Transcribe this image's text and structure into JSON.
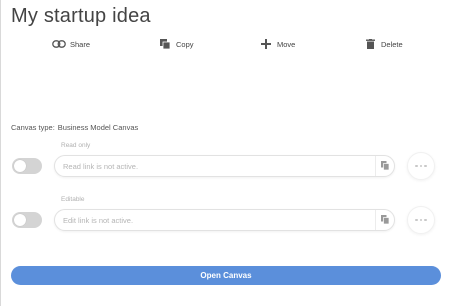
{
  "title": "My startup idea",
  "actions": {
    "share": {
      "label": "Share",
      "icon": "link-icon"
    },
    "copy": {
      "label": "Copy",
      "icon": "copy-icon"
    },
    "move": {
      "label": "Move",
      "icon": "move-icon"
    },
    "delete": {
      "label": "Delete",
      "icon": "trash-icon"
    }
  },
  "canvas_type": {
    "label": "Canvas type:",
    "value": "Business Model Canvas"
  },
  "read_only": {
    "label": "Read only",
    "value": "Read link is not active.",
    "enabled": false
  },
  "editable": {
    "label": "Editable",
    "value": "Edit link is not active.",
    "enabled": false
  },
  "open_button": {
    "label": "Open Canvas"
  },
  "colors": {
    "accent": "#5b8fdb",
    "toggle_off": "#d4d4d4",
    "placeholder_text": "#b5b5b5"
  }
}
